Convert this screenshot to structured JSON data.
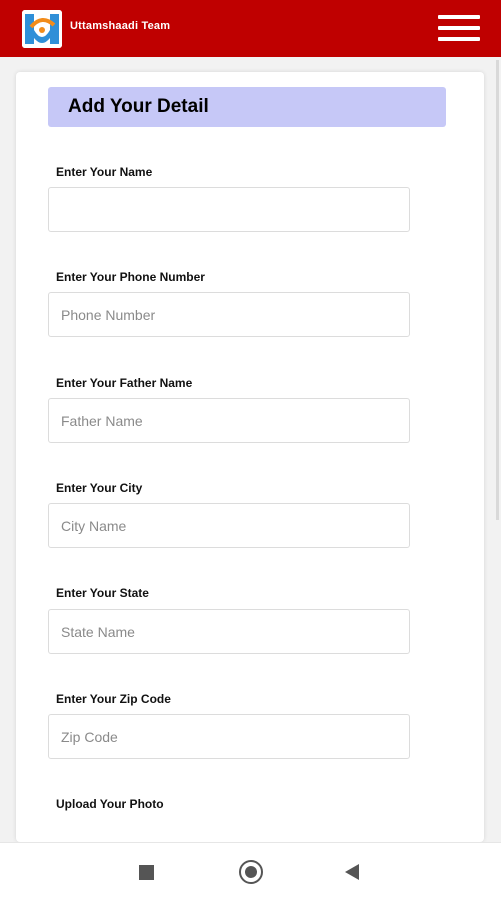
{
  "app": {
    "title": "Uttamshaadi Team",
    "brand_color": "#bf0000"
  },
  "header": {
    "menu_icon": "hamburger-menu-icon"
  },
  "form": {
    "heading": "Add Your Detail",
    "name_label": "Enter Your Name",
    "name_placeholder": "",
    "phone_label": "Enter Your Phone Number",
    "phone_placeholder": "Phone Number",
    "father_label": "Enter Your Father Name",
    "father_placeholder": "Father Name",
    "city_label": "Enter Your City",
    "city_placeholder": "City Name",
    "state_label": "Enter Your State",
    "state_placeholder": "State Name",
    "zip_label": "Enter Your Zip Code",
    "zip_placeholder": "Zip Code",
    "photo_label": "Upload Your Photo"
  },
  "navigation": {
    "recents_icon": "square-recents-icon",
    "home_icon": "circle-home-icon",
    "back_icon": "triangle-back-icon"
  }
}
